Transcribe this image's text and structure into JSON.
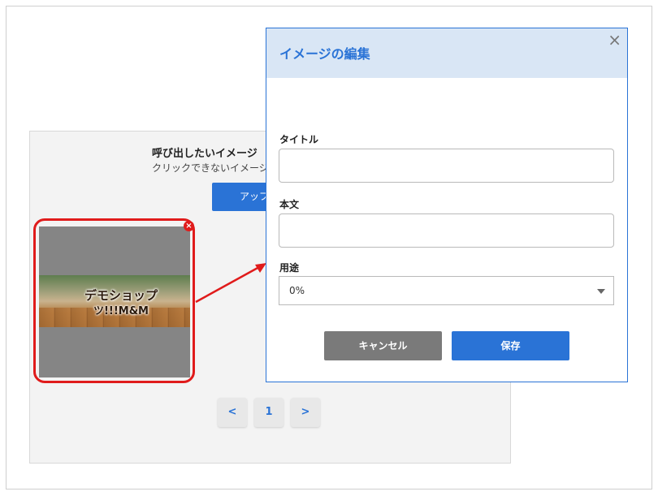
{
  "background": {
    "heading": "呼び出したいイメージ",
    "subheading": "クリックできないイメージ",
    "upload_label": "アップ"
  },
  "thumbnail": {
    "banner_line1": "デモショップ",
    "banner_line2": "ツ!!!M&M",
    "delete_glyph": "×"
  },
  "pager": {
    "prev": "<",
    "page": "1",
    "next": ">"
  },
  "modal": {
    "title": "イメージの編集",
    "close_glyph": "×",
    "fields": {
      "title_label": "タイトル",
      "title_value": "",
      "body_label": "本文",
      "body_value": "",
      "usage_label": "用途",
      "usage_value": "0%"
    },
    "cancel_label": "キャンセル",
    "save_label": "保存"
  },
  "colors": {
    "accent": "#2a73d6",
    "highlight": "#e01b1b",
    "header_bg": "#d9e6f5",
    "cancel_bg": "#7a7a7a"
  }
}
